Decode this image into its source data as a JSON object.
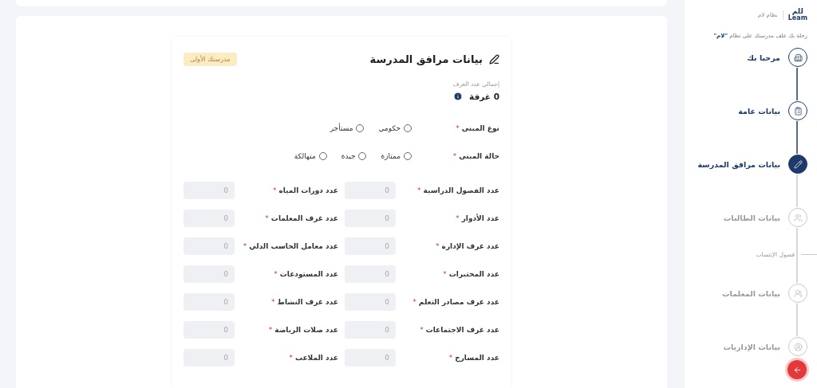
{
  "sidebar": {
    "logo": {
      "arabic": "للم",
      "latin": "Leam"
    },
    "system_name": "نظام لام",
    "tagline": "رحلة بك علف مدرستك على نظام **\"لام\"**",
    "steps": [
      {
        "label": "مرحبا بك",
        "completed": true,
        "selected": false
      },
      {
        "label": "بيانات عامة",
        "completed": true,
        "selected": false
      },
      {
        "label": "بيانات مرافق المدرسة",
        "completed": false,
        "selected": true
      },
      {
        "label": "بيانات الطالبات",
        "completed": false,
        "selected": false,
        "children": [
          {
            "label": "فصول الإنتساب"
          }
        ]
      },
      {
        "label": "بيانات المعلمات",
        "completed": false,
        "selected": false
      },
      {
        "label": "بيانات الإداريات",
        "completed": false,
        "selected": false
      }
    ]
  },
  "form": {
    "title": "بيانات مرافق المدرسة",
    "badge": "مدرستك الأولى",
    "total_rooms": {
      "label": "إجمالي عدد الغرف",
      "value": "0 غرفة"
    },
    "radio_groups": [
      {
        "label": "نوع المبنى",
        "mark": "*",
        "options": [
          {
            "label": "حكومي",
            "selected": false
          },
          {
            "label": "مستأجر",
            "selected": false
          }
        ]
      },
      {
        "label": "حالة المبنى",
        "mark": "*",
        "options": [
          {
            "label": "ممتازة",
            "selected": false
          },
          {
            "label": "جيدة",
            "selected": false
          },
          {
            "label": "متهالكة",
            "selected": false
          }
        ]
      }
    ],
    "counts": [
      {
        "label": "عدد الفصول الدراسية",
        "mark": "*",
        "placeholder": "0"
      },
      {
        "label": "عدد دورات المياه",
        "mark": "*",
        "placeholder": "0"
      },
      {
        "label": "عدد الأدوار",
        "mark": "*",
        "placeholder": "0"
      },
      {
        "label": "عدد غرف المعلمات",
        "mark": "*",
        "placeholder": "0"
      },
      {
        "label": "عدد غرف الإدارة",
        "mark": "*",
        "placeholder": "0"
      },
      {
        "label": "عدد معامل الحاسب الدلي",
        "mark": "*",
        "placeholder": "0"
      },
      {
        "label": "عدد المختبرات",
        "mark": "*",
        "placeholder": "0"
      },
      {
        "label": "عدد المستودعات",
        "mark": "*",
        "placeholder": "0"
      },
      {
        "label": "عدد غرف مصادر التعلم",
        "mark": "*",
        "placeholder": "0"
      },
      {
        "label": "عدد غرف النشاط",
        "mark": "*",
        "placeholder": "0"
      },
      {
        "label": "عدد غرف الاجتماعات",
        "mark": "*",
        "placeholder": "0"
      },
      {
        "label": "عدد صلات الرياضة",
        "mark": "*",
        "placeholder": "0"
      },
      {
        "label": "عدد المسارح",
        "mark": "*",
        "placeholder": "0"
      },
      {
        "label": "عدد الملاعب",
        "mark": "*",
        "placeholder": "0"
      }
    ]
  }
}
